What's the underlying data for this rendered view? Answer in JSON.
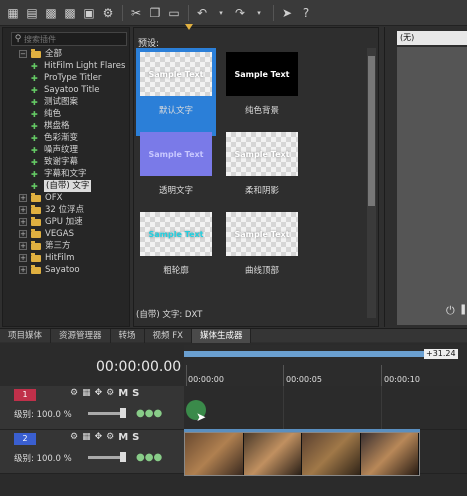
{
  "toolbar": {
    "icons": [
      "new-icon",
      "open-icon",
      "save-icon",
      "save-as-icon",
      "render-icon",
      "properties-icon",
      "cut-icon",
      "copy-icon",
      "paste-icon",
      "undo-icon",
      "redo-icon",
      "snap-icon",
      "help-icon"
    ]
  },
  "tree": {
    "search_placeholder": "搜索插件",
    "items": [
      {
        "label": "全部",
        "type": "folder",
        "expanded": true
      },
      {
        "label": "HitFilm Light Flares",
        "type": "plugin"
      },
      {
        "label": "ProType Titler",
        "type": "plugin"
      },
      {
        "label": "Sayatoo Title",
        "type": "plugin"
      },
      {
        "label": "测试图案",
        "type": "plugin"
      },
      {
        "label": "纯色",
        "type": "plugin"
      },
      {
        "label": "棋盘格",
        "type": "plugin"
      },
      {
        "label": "色彩渐变",
        "type": "plugin"
      },
      {
        "label": "噪声纹理",
        "type": "plugin"
      },
      {
        "label": "致谢字幕",
        "type": "plugin"
      },
      {
        "label": "字幕和文字",
        "type": "plugin"
      },
      {
        "label": "(自带) 文字",
        "type": "plugin",
        "selected": true
      },
      {
        "label": "OFX",
        "type": "folder"
      },
      {
        "label": "32 位浮点",
        "type": "folder"
      },
      {
        "label": "GPU 加速",
        "type": "folder"
      },
      {
        "label": "VEGAS",
        "type": "folder"
      },
      {
        "label": "第三方",
        "type": "folder"
      },
      {
        "label": "HitFilm",
        "type": "folder"
      },
      {
        "label": "Sayatoo",
        "type": "folder"
      }
    ]
  },
  "presets": {
    "title": "预设:",
    "status": "(自带) 文字: DXT",
    "items": [
      {
        "label": "默认文字",
        "thumb_text": "Sample Text",
        "style": "checker-white",
        "selected": true
      },
      {
        "label": "纯色背景",
        "thumb_text": "Sample Text",
        "style": "black"
      },
      {
        "label": "透明文字",
        "thumb_text": "Sample Text",
        "style": "blue"
      },
      {
        "label": "柔和阴影",
        "thumb_text": "Sample Text",
        "style": "checker-white"
      },
      {
        "label": "粗轮廓",
        "thumb_text": "Sample Text",
        "style": "checker-cyan"
      },
      {
        "label": "曲线顶部",
        "thumb_text": "Sample Text",
        "style": "checker-white"
      }
    ]
  },
  "preview": {
    "select_value": "(无)"
  },
  "tabs": [
    {
      "label": "项目媒体",
      "active": false
    },
    {
      "label": "资源管理器",
      "active": false
    },
    {
      "label": "转场",
      "active": false
    },
    {
      "label": "视频 FX",
      "active": false
    },
    {
      "label": "媒体生成器",
      "active": true
    }
  ],
  "timeline": {
    "time": "00:00:00.00",
    "ruler_end": "+31.24",
    "ticks": [
      "00:00:00",
      "00:00:05",
      "00:00:10"
    ],
    "tracks": [
      {
        "number": "1",
        "level_label": "级别: 100.0 %",
        "color": "#c0304a"
      },
      {
        "number": "2",
        "level_label": "级别: 100.0 %",
        "color": "#3a5fd0"
      }
    ]
  },
  "colors": {
    "accent_selected": "#2b7fd8",
    "folder": "#e0b040",
    "plugin": "#64c864"
  }
}
